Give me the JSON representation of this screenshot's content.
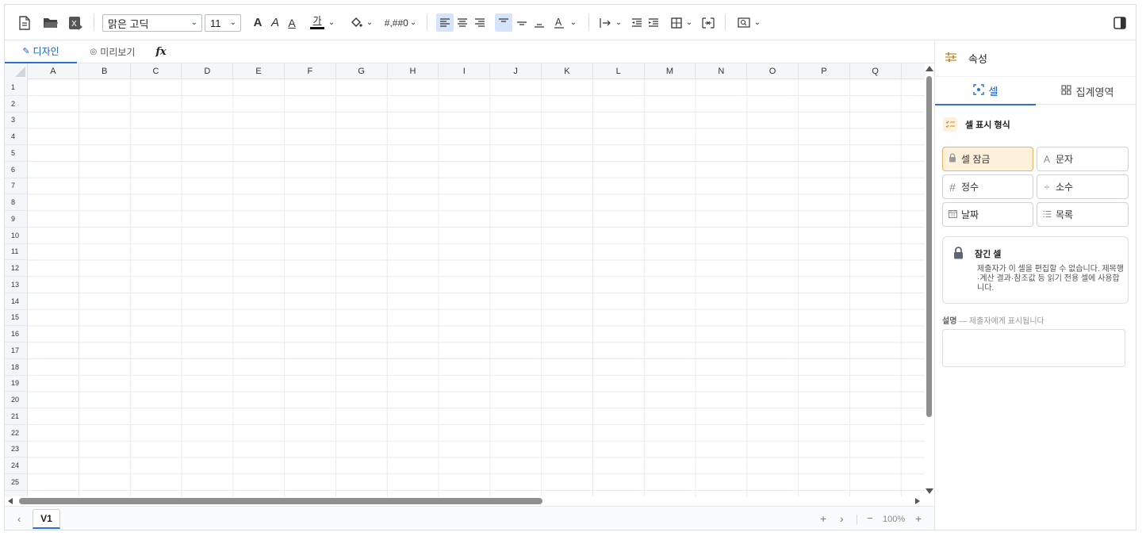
{
  "toolbar": {
    "font_family": "맑은 고딕",
    "font_size": "11",
    "text_color_label": "가",
    "number_format_label": "#,##0",
    "bold_label": "A",
    "italic_label": "A",
    "underline_label": "A"
  },
  "view_tabs": {
    "design": "디자인",
    "preview": "미리보기",
    "formula": "fx"
  },
  "grid": {
    "columns": [
      "A",
      "B",
      "C",
      "D",
      "E",
      "F",
      "G",
      "H",
      "I",
      "J",
      "K",
      "L",
      "M",
      "N",
      "O",
      "P",
      "Q"
    ],
    "rows": [
      "1",
      "2",
      "3",
      "4",
      "5",
      "6",
      "7",
      "8",
      "9",
      "10",
      "11",
      "12",
      "13",
      "14",
      "15",
      "16",
      "17",
      "18",
      "19",
      "20",
      "21",
      "22",
      "23",
      "24",
      "25"
    ]
  },
  "sheetbar": {
    "sheet_tab": "V1",
    "add": "+",
    "next": "›",
    "prev": "‹",
    "zoom_out": "−",
    "zoom": "100%",
    "zoom_in": "+"
  },
  "properties": {
    "title": "속성",
    "tab_cell": "셀",
    "tab_aggregate": "집계영역",
    "section_title": "셀 표시 형식",
    "formats": {
      "lock": "셀 잠금",
      "text": "문자",
      "integer": "정수",
      "decimal": "소수",
      "date": "날짜",
      "list": "목록"
    },
    "info_title": "잠긴 셀",
    "info_text": "제출자가 이 셀을 편집할 수 없습니다. 제목행·계산 결과·참조값 등 읽기 전용 셀에 사용합니다.",
    "desc_label": "설명",
    "desc_hint": "— 제출자에게 표시됩니다"
  },
  "colors": {
    "accent": "#2c6fd6",
    "lock_active_bg": "#fdf1dc",
    "lock_active_border": "#e2b566",
    "icon_orange": "#c98a2a"
  }
}
